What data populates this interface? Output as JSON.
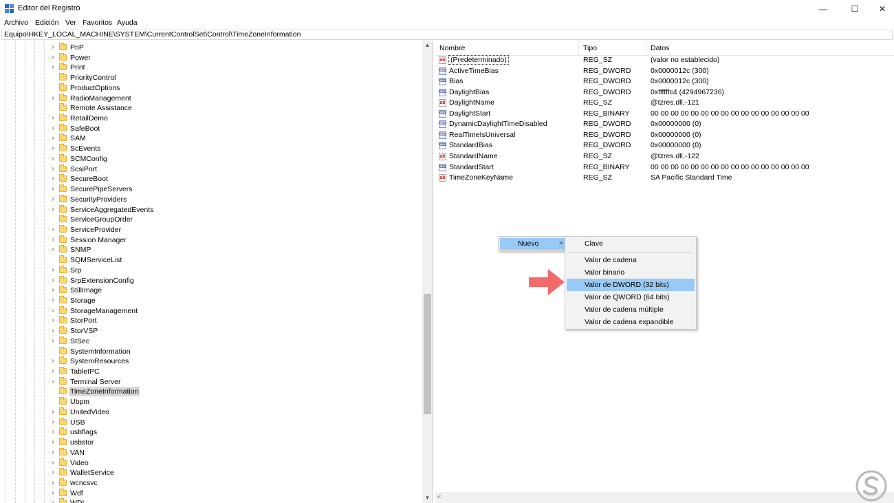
{
  "window": {
    "title": "Editor del Registro",
    "minimize_icon": "—",
    "maximize_icon": "☐",
    "close_icon": "✕"
  },
  "menubar": {
    "items": [
      "Archivo",
      "Edición",
      "Ver",
      "Favoritos",
      "Ayuda"
    ]
  },
  "address": {
    "path": "Equipo\\HKEY_LOCAL_MACHINE\\SYSTEM\\CurrentControlSet\\Control\\TimeZoneInformation"
  },
  "tree": {
    "items": [
      {
        "label": "PnP",
        "expandable": true
      },
      {
        "label": "Power",
        "expandable": true
      },
      {
        "label": "Print",
        "expandable": true
      },
      {
        "label": "PriorityControl",
        "expandable": false
      },
      {
        "label": "ProductOptions",
        "expandable": false
      },
      {
        "label": "RadioManagement",
        "expandable": true
      },
      {
        "label": "Remote Assistance",
        "expandable": false
      },
      {
        "label": "RetailDemo",
        "expandable": true
      },
      {
        "label": "SafeBoot",
        "expandable": true
      },
      {
        "label": "SAM",
        "expandable": true
      },
      {
        "label": "ScEvents",
        "expandable": true
      },
      {
        "label": "SCMConfig",
        "expandable": true
      },
      {
        "label": "ScsiPort",
        "expandable": true
      },
      {
        "label": "SecureBoot",
        "expandable": true
      },
      {
        "label": "SecurePipeServers",
        "expandable": true
      },
      {
        "label": "SecurityProviders",
        "expandable": true
      },
      {
        "label": "ServiceAggregatedEvents",
        "expandable": true
      },
      {
        "label": "ServiceGroupOrder",
        "expandable": false
      },
      {
        "label": "ServiceProvider",
        "expandable": true
      },
      {
        "label": "Session Manager",
        "expandable": true
      },
      {
        "label": "SNMP",
        "expandable": true
      },
      {
        "label": "SQMServiceList",
        "expandable": false
      },
      {
        "label": "Srp",
        "expandable": true
      },
      {
        "label": "SrpExtensionConfig",
        "expandable": true
      },
      {
        "label": "StillImage",
        "expandable": true
      },
      {
        "label": "Storage",
        "expandable": true
      },
      {
        "label": "StorageManagement",
        "expandable": true
      },
      {
        "label": "StorPort",
        "expandable": true
      },
      {
        "label": "StorVSP",
        "expandable": true
      },
      {
        "label": "StSec",
        "expandable": true
      },
      {
        "label": "SystemInformation",
        "expandable": false
      },
      {
        "label": "SystemResources",
        "expandable": true
      },
      {
        "label": "TabletPC",
        "expandable": true
      },
      {
        "label": "Terminal Server",
        "expandable": true
      },
      {
        "label": "TimeZoneInformation",
        "expandable": false,
        "selected": true
      },
      {
        "label": "Ubpm",
        "expandable": false
      },
      {
        "label": "UnitedVideo",
        "expandable": true
      },
      {
        "label": "USB",
        "expandable": true
      },
      {
        "label": "usbflags",
        "expandable": true
      },
      {
        "label": "usbstor",
        "expandable": true
      },
      {
        "label": "VAN",
        "expandable": true
      },
      {
        "label": "Video",
        "expandable": true
      },
      {
        "label": "WalletService",
        "expandable": true
      },
      {
        "label": "wcncsvc",
        "expandable": true
      },
      {
        "label": "Wdf",
        "expandable": true
      },
      {
        "label": "WDI",
        "expandable": true
      }
    ]
  },
  "list": {
    "columns": [
      "Nombre",
      "Tipo",
      "Datos"
    ],
    "rows": [
      {
        "icon": "string-value-icon",
        "name": "(Predeterminado)",
        "type": "REG_SZ",
        "data": "(valor no establecido)",
        "focused": true
      },
      {
        "icon": "binary-value-icon",
        "name": "ActiveTimeBias",
        "type": "REG_DWORD",
        "data": "0x0000012c (300)"
      },
      {
        "icon": "binary-value-icon",
        "name": "Bias",
        "type": "REG_DWORD",
        "data": "0x0000012c (300)"
      },
      {
        "icon": "binary-value-icon",
        "name": "DaylightBias",
        "type": "REG_DWORD",
        "data": "0xffffffc4 (4294967236)"
      },
      {
        "icon": "string-value-icon",
        "name": "DaylightName",
        "type": "REG_SZ",
        "data": "@tzres.dll,-121"
      },
      {
        "icon": "binary-value-icon",
        "name": "DaylightStart",
        "type": "REG_BINARY",
        "data": "00 00 00 00 00 00 00 00 00 00 00 00 00 00 00 00"
      },
      {
        "icon": "binary-value-icon",
        "name": "DynamicDaylightTimeDisabled",
        "type": "REG_DWORD",
        "data": "0x00000000 (0)"
      },
      {
        "icon": "binary-value-icon",
        "name": "RealTimeIsUniversal",
        "type": "REG_DWORD",
        "data": "0x00000000 (0)"
      },
      {
        "icon": "binary-value-icon",
        "name": "StandardBias",
        "type": "REG_DWORD",
        "data": "0x00000000 (0)"
      },
      {
        "icon": "string-value-icon",
        "name": "StandardName",
        "type": "REG_SZ",
        "data": "@tzres.dll,-122"
      },
      {
        "icon": "binary-value-icon",
        "name": "StandardStart",
        "type": "REG_BINARY",
        "data": "00 00 00 00 00 00 00 00 00 00 00 00 00 00 00 00"
      },
      {
        "icon": "string-value-icon",
        "name": "TimeZoneKeyName",
        "type": "REG_SZ",
        "data": "SA Pacific Standard Time"
      }
    ]
  },
  "context_menu": {
    "nuevo_label": "Nuevo",
    "submenu_arrow": ">",
    "submenu": [
      {
        "label": "Clave"
      },
      {
        "label": "Valor de cadena"
      },
      {
        "label": "Valor binario"
      },
      {
        "label": "Valor de DWORD (32 bits)",
        "highlighted": true
      },
      {
        "label": "Valor de QWORD (64 bits)"
      },
      {
        "label": "Valor de cadena múltiple"
      },
      {
        "label": "Valor de cadena expandible"
      }
    ]
  },
  "icons": {
    "string_value_glyph": "ab",
    "binary_value_glyph": "011",
    "chevron_right": "›",
    "scroll_up": "▲",
    "scroll_down": "▼",
    "scroll_left": "<"
  },
  "colors": {
    "highlight": "#99c9f5",
    "selected_tree": "#d9d9d9",
    "annotation_arrow": "#f26b6b",
    "logo": "#b9b9b9"
  }
}
